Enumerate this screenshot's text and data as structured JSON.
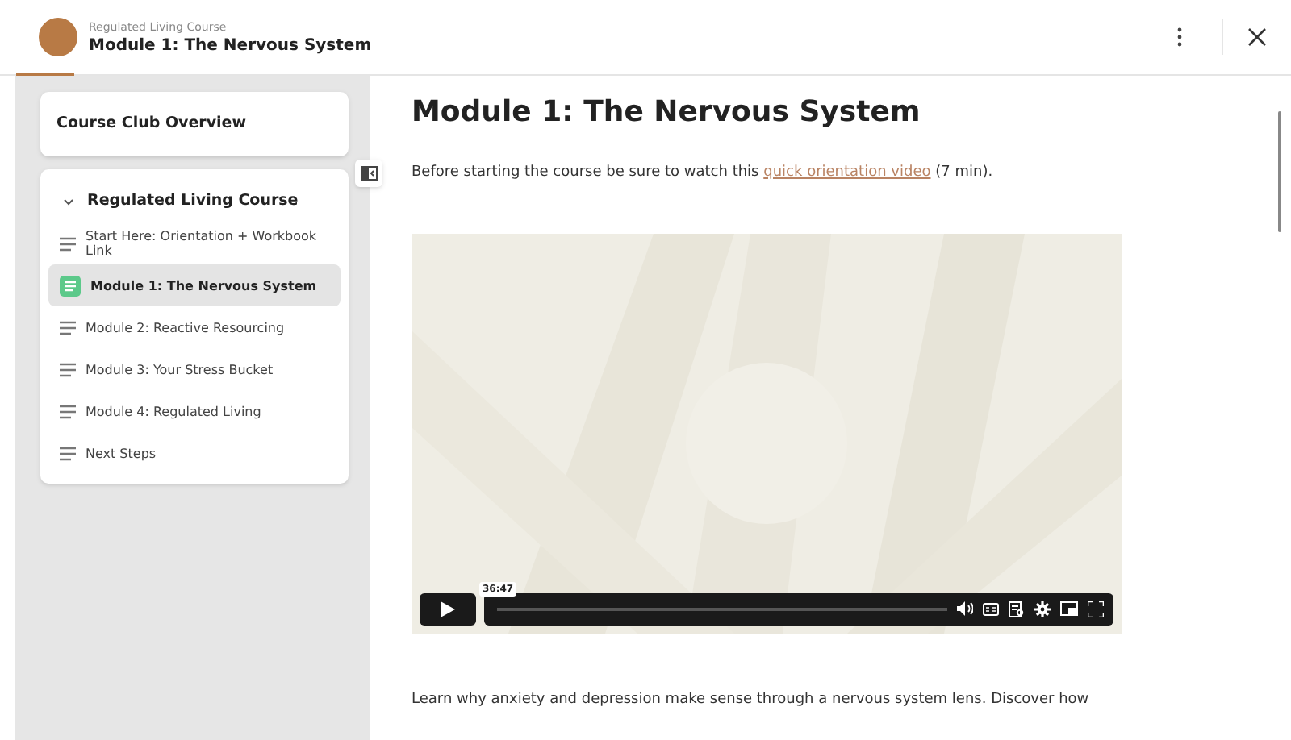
{
  "header": {
    "course": "Regulated Living Course",
    "title": "Module 1: The Nervous System"
  },
  "sidebar": {
    "overview": "Course Club Overview",
    "section": {
      "title": "Regulated Living Course",
      "expanded": true,
      "items": [
        {
          "label": "Start Here: Orientation + Workbook Link",
          "selected": false
        },
        {
          "label": "Module 1: The Nervous System",
          "selected": true
        },
        {
          "label": "Module 2: Reactive Resourcing",
          "selected": false
        },
        {
          "label": "Module 3: Your Stress Bucket",
          "selected": false
        },
        {
          "label": "Module 4: Regulated Living",
          "selected": false
        },
        {
          "label": "Next Steps",
          "selected": false
        }
      ]
    }
  },
  "main": {
    "heading": "Module 1: The Nervous System",
    "intro_before": "Before starting the course be sure to watch this",
    "intro_link": "quick orientation video",
    "intro_after": "(7 min).",
    "video": {
      "duration": "36:47"
    },
    "body": "Learn why anxiety and depression make sense through a nervous system lens. Discover how"
  }
}
